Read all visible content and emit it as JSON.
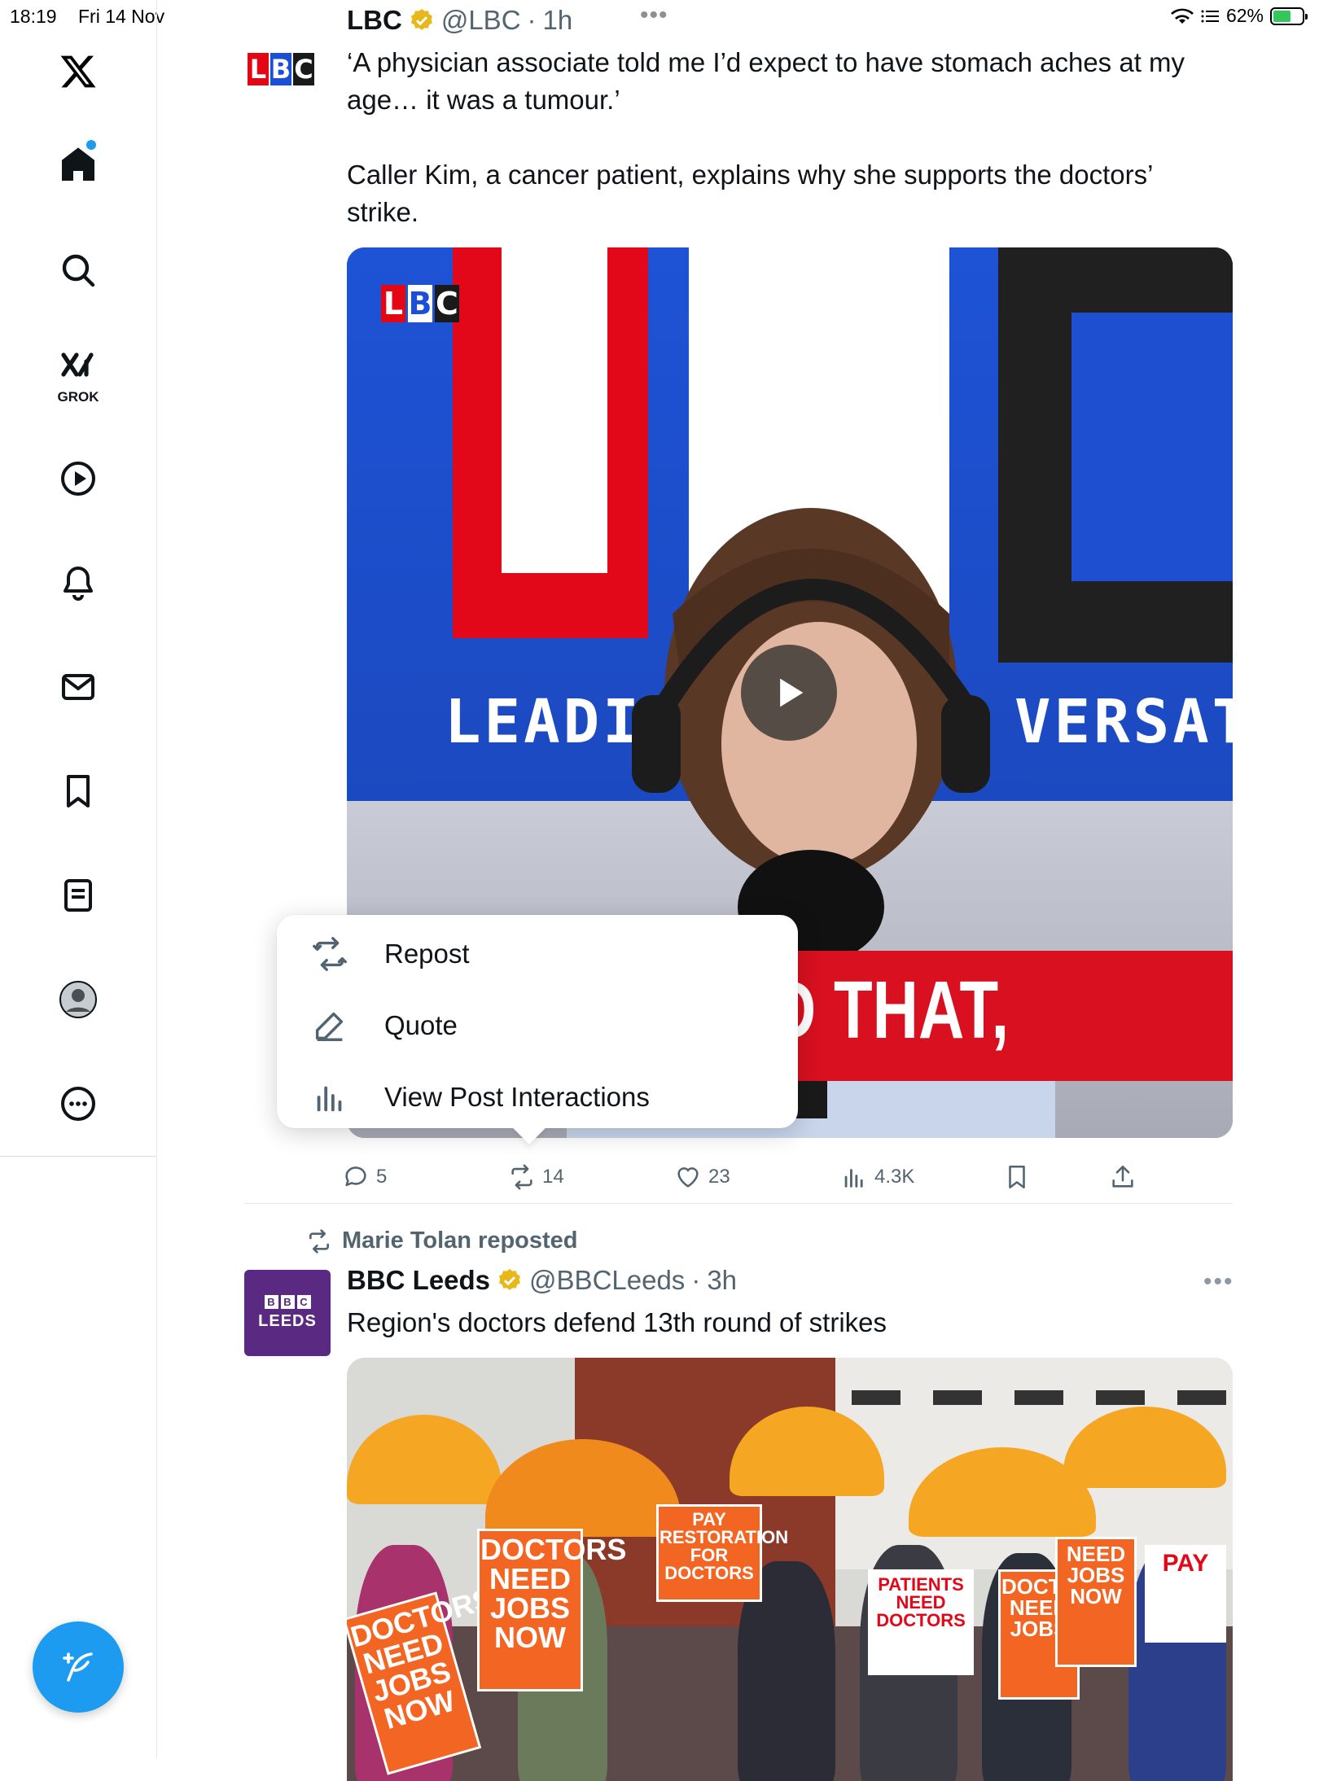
{
  "status_bar": {
    "time": "18:19",
    "date": "Fri 14 Nov",
    "battery": "62%",
    "battery_level": 0.62
  },
  "sidebar": {
    "grok_label": "GROK",
    "items": [
      "x-logo",
      "home",
      "search",
      "grok",
      "videos",
      "notifications",
      "messages",
      "bookmarks",
      "lists",
      "profile",
      "more"
    ]
  },
  "post1": {
    "name": "LBC",
    "handle": "@LBC",
    "time": "1h",
    "text": "‘A physician associate told me I’d expect to have stomach aches at my\nage… it was a tumour.’\n\nCaller Kim, a cancer patient, explains why she supports the doctors’\nstrike.",
    "media": {
      "logo_letters": [
        "L",
        "B",
        "C"
      ],
      "tagline_left": "LEADI",
      "tagline_right": "VERSATI",
      "caption": "D THAT,"
    },
    "actions": {
      "replies": "5",
      "reposts": "14",
      "likes": "23",
      "views": "4.3K"
    }
  },
  "repost_menu": {
    "items": [
      {
        "label": "Repost",
        "icon": "repost-icon"
      },
      {
        "label": "Quote",
        "icon": "pencil-icon"
      },
      {
        "label": "View Post Interactions",
        "icon": "bar-chart-icon"
      }
    ]
  },
  "post2": {
    "reposted_by": "Marie Tolan reposted",
    "name": "BBC Leeds",
    "handle": "@BBCLeeds",
    "time": "3h",
    "text": "Region's doctors defend 13th round of strikes",
    "avatar": {
      "blocks": [
        "B",
        "B",
        "C"
      ],
      "label": "LEEDS"
    },
    "photo_signs": [
      "DOCTORS NEED JOBS NOW",
      "PAY RESTORATION FOR DOCTORS",
      "PATIENTS NEED DOCTORS",
      "DOCTORS NEED JOBS",
      "NEED JOBS NOW",
      "PAY"
    ]
  },
  "colors": {
    "accent": "#1d9bf0",
    "verified": "#e8b71a",
    "lbc_red": "#e30613",
    "lbc_blue": "#1d4ed8",
    "bbc_purple": "#5a2a82"
  }
}
